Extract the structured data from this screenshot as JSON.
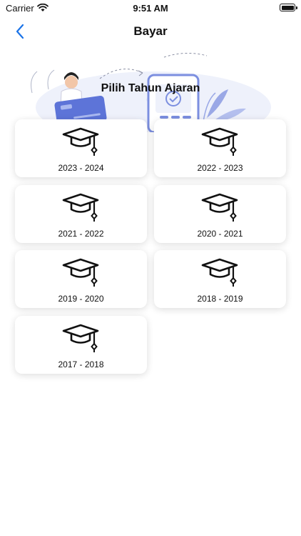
{
  "status_bar": {
    "carrier": "Carrier",
    "time": "9:51 AM"
  },
  "nav": {
    "title": "Bayar",
    "back_icon": "chevron-left-icon"
  },
  "hero": {
    "title": "Pilih Tahun Ajaran"
  },
  "years": [
    {
      "label": "2023 - 2024",
      "icon": "graduation-cap-icon"
    },
    {
      "label": "2022 - 2023",
      "icon": "graduation-cap-icon"
    },
    {
      "label": "2021 - 2022",
      "icon": "graduation-cap-icon"
    },
    {
      "label": "2020 - 2021",
      "icon": "graduation-cap-icon"
    },
    {
      "label": "2019 - 2020",
      "icon": "graduation-cap-icon"
    },
    {
      "label": "2018 - 2019",
      "icon": "graduation-cap-icon"
    },
    {
      "label": "2017 - 2018",
      "icon": "graduation-cap-icon"
    }
  ],
  "colors": {
    "accent": "#1a73e8",
    "illustration": "#7c8fe0"
  }
}
